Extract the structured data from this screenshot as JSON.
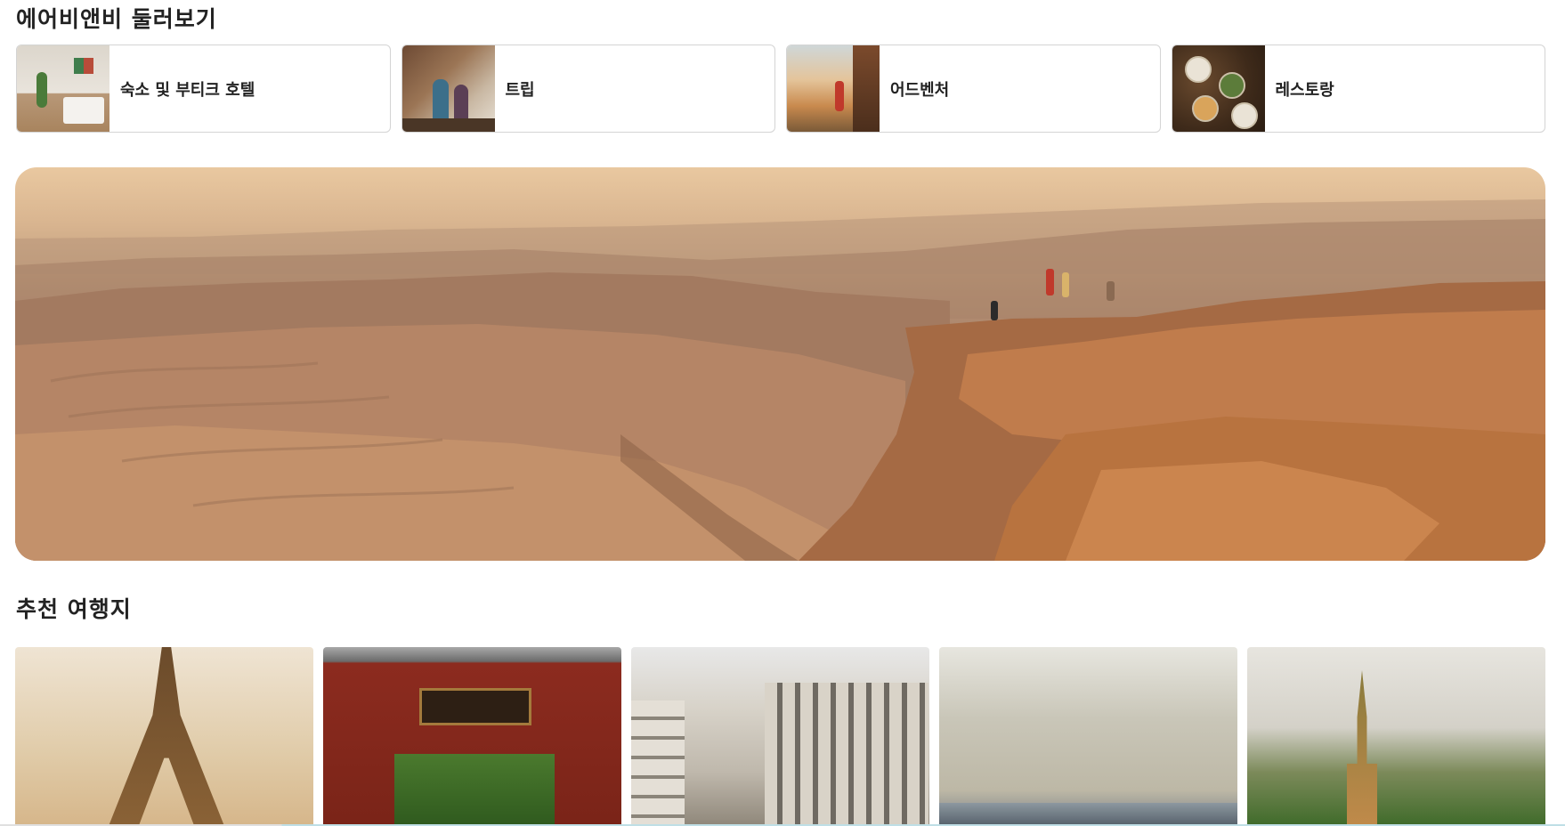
{
  "explore": {
    "title": "에어비앤비 둘러보기",
    "categories": [
      {
        "label": "숙소 및 부티크 호텔",
        "image": "hotel-room-photo"
      },
      {
        "label": "트립",
        "image": "trip-cooking-photo"
      },
      {
        "label": "어드벤처",
        "image": "adventure-hiker-photo"
      },
      {
        "label": "레스토랑",
        "image": "restaurant-table-photo"
      }
    ]
  },
  "hero": {
    "image": "desert-canyon-overlook-photo"
  },
  "destinations": {
    "title": "추천 여행지",
    "items": [
      {
        "image": "eiffel-tower-photo"
      },
      {
        "image": "korean-gate-photo"
      },
      {
        "image": "london-street-photo"
      },
      {
        "image": "seaside-promenade-photo"
      },
      {
        "image": "barcelona-park-photo"
      }
    ]
  }
}
